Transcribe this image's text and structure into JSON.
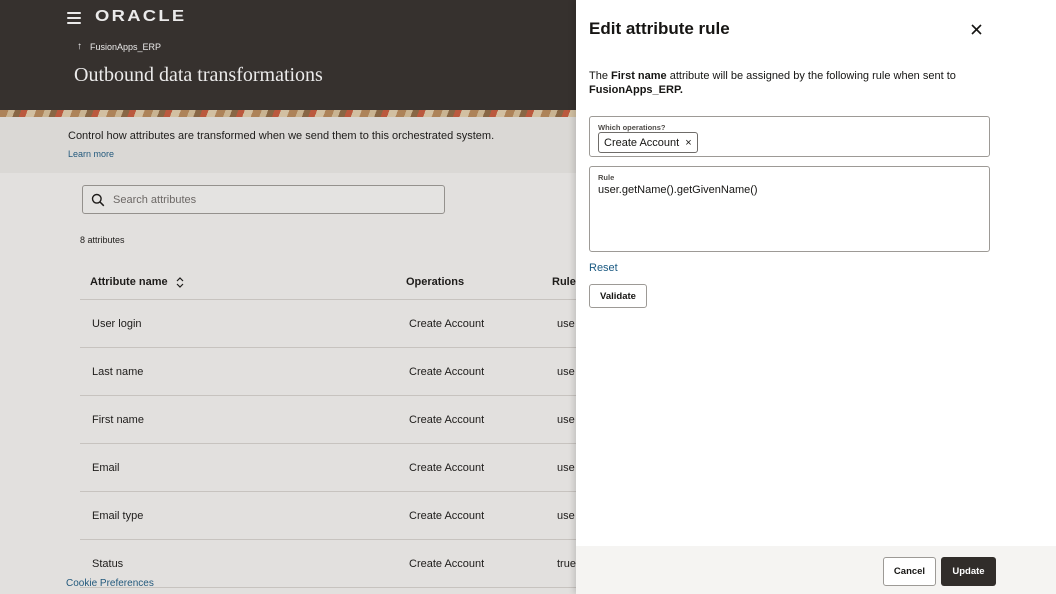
{
  "header": {
    "logo": "ORACLE",
    "back_label": "FusionApps_ERP",
    "title": "Outbound data transformations"
  },
  "intro": {
    "text": "Control how attributes are transformed when we send them to this orchestrated system.",
    "learn_more": "Learn more"
  },
  "search": {
    "placeholder": "Search attributes"
  },
  "count": "8 attributes",
  "table": {
    "headers": [
      "Attribute name",
      "Operations",
      "Rule"
    ],
    "rows": [
      {
        "name": "User login",
        "operations": "Create Account",
        "rule": "use"
      },
      {
        "name": "Last name",
        "operations": "Create Account",
        "rule": "use"
      },
      {
        "name": "First name",
        "operations": "Create Account",
        "rule": "use"
      },
      {
        "name": "Email",
        "operations": "Create Account",
        "rule": "use"
      },
      {
        "name": "Email type",
        "operations": "Create Account",
        "rule": "use"
      },
      {
        "name": "Status",
        "operations": "Create Account",
        "rule": "true"
      }
    ]
  },
  "footer_link": "Cookie Preferences",
  "drawer": {
    "title": "Edit attribute rule",
    "desc_prefix": "The ",
    "desc_attr": "First name",
    "desc_mid": " attribute will be assigned by the following rule when sent to ",
    "desc_system": "FusionApps_ERP",
    "desc_suffix": ".",
    "ops_label": "Which operations?",
    "ops_chip": "Create Account",
    "rule_label": "Rule",
    "rule_value": "user.getName().getGivenName()",
    "reset": "Reset",
    "validate": "Validate",
    "cancel": "Cancel",
    "update": "Update"
  },
  "colors": {
    "header_bg": "#312d2a",
    "link": "#1b5a82",
    "primary_button": "#312d2a"
  }
}
